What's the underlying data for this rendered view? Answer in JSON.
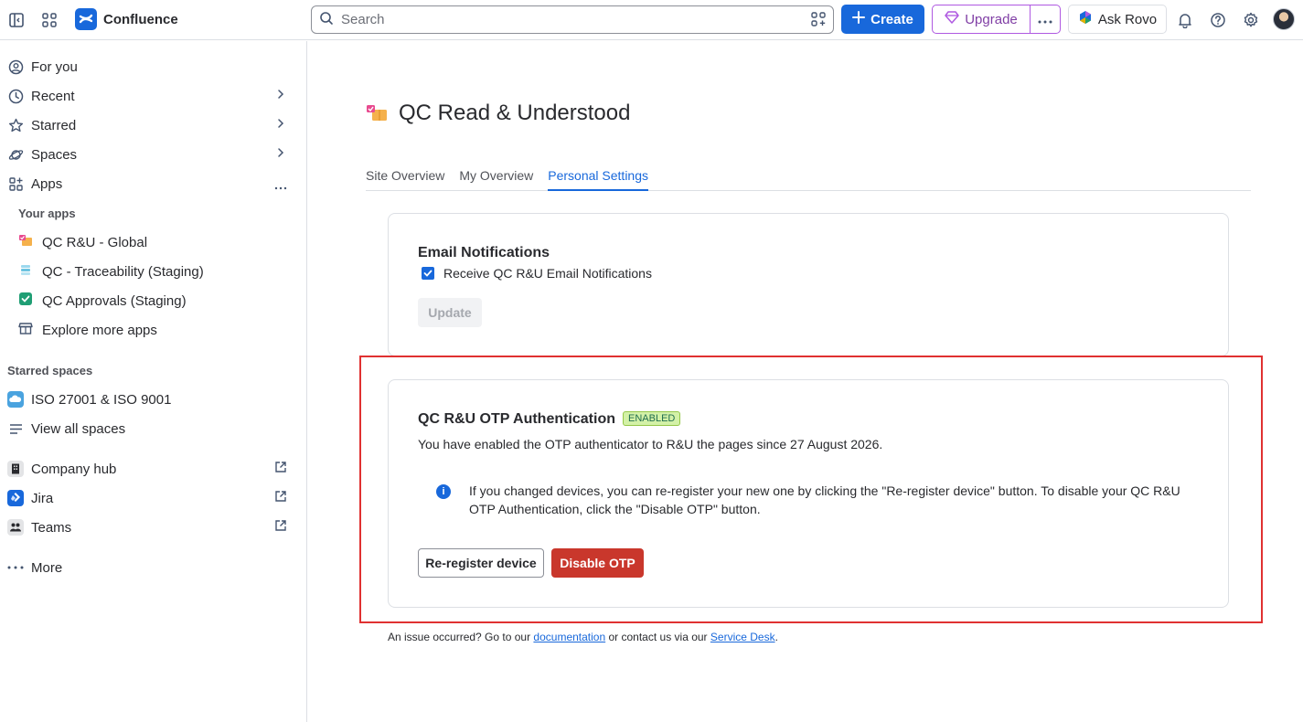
{
  "topbar": {
    "app_name": "Confluence",
    "search_placeholder": "Search",
    "create_label": "Create",
    "upgrade_label": "Upgrade",
    "ask_rovo_label": "Ask Rovo"
  },
  "sidebar": {
    "items": [
      {
        "label": "For you"
      },
      {
        "label": "Recent"
      },
      {
        "label": "Starred"
      },
      {
        "label": "Spaces"
      },
      {
        "label": "Apps"
      }
    ],
    "your_apps_label": "Your apps",
    "apps": [
      {
        "label": "QC R&U - Global"
      },
      {
        "label": "QC - Traceability (Staging)"
      },
      {
        "label": "QC Approvals (Staging)"
      },
      {
        "label": "Explore more apps"
      }
    ],
    "starred_spaces_label": "Starred spaces",
    "spaces": [
      {
        "label": "ISO 27001 & ISO 9001"
      },
      {
        "label": "View all spaces"
      }
    ],
    "links": [
      {
        "label": "Company hub"
      },
      {
        "label": "Jira"
      },
      {
        "label": "Teams"
      }
    ],
    "more_label": "More"
  },
  "main": {
    "title": "QC Read & Understood",
    "tabs": [
      {
        "label": "Site Overview"
      },
      {
        "label": "My Overview"
      },
      {
        "label": "Personal Settings"
      }
    ],
    "email_card": {
      "title": "Email Notifications",
      "checkbox_label": "Receive QC R&U Email Notifications",
      "checkbox_checked": true,
      "update_label": "Update"
    },
    "otp_card": {
      "title": "QC R&U OTP Authentication",
      "badge": "ENABLED",
      "description": "You have enabled the OTP authenticator to R&U the pages since 27 August 2026.",
      "info_text": "If you changed devices, you can re-register your new one by clicking the \"Re-register device\" button. To disable your QC R&U OTP Authentication, click the \"Disable OTP\" button.",
      "reregister_label": "Re-register device",
      "disable_label": "Disable OTP"
    },
    "footer": {
      "prefix": "An issue occurred? Go to our ",
      "doc_link": "documentation",
      "middle": " or contact us via our ",
      "desk_link": "Service Desk",
      "suffix": "."
    }
  },
  "colors": {
    "brand": "#1868db",
    "danger": "#c9372c",
    "upgrade": "#af59e1",
    "highlight": "#e03131",
    "badge_bg": "#d3f1a7"
  }
}
